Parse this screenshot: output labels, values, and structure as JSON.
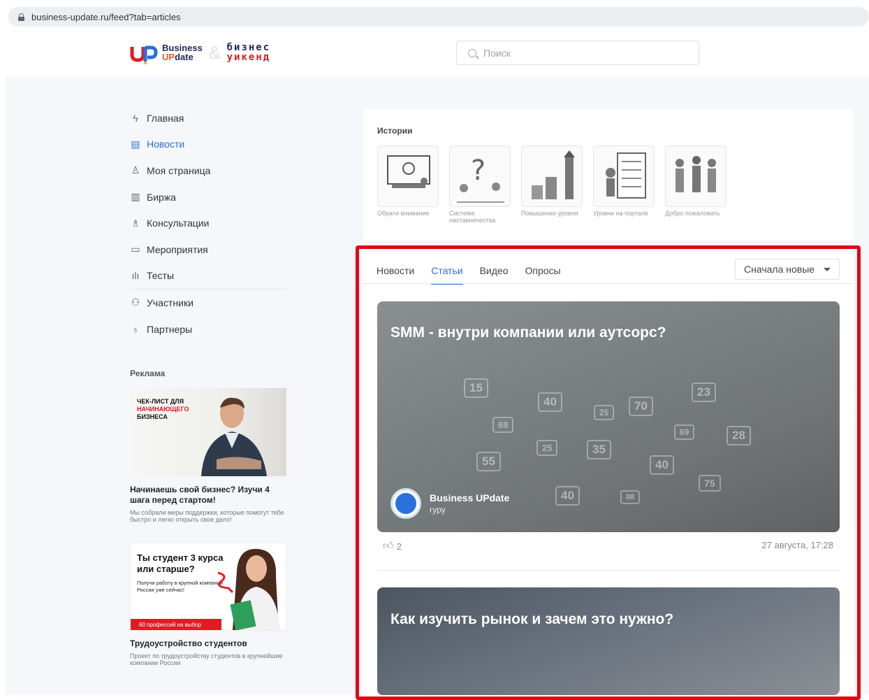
{
  "browser": {
    "url": "business-update.ru/feed?tab=articles"
  },
  "header": {
    "logo_business": "Business",
    "logo_up": "UP",
    "logo_date": "date",
    "logo_bw_line1": "бизнес",
    "logo_bw_line2": "уикенд",
    "search_placeholder": "Поиск"
  },
  "sidebar": {
    "items": [
      {
        "label": "Главная",
        "icon": "lightning-icon"
      },
      {
        "label": "Новости",
        "icon": "newspaper-icon",
        "active": true
      },
      {
        "label": "Моя страница",
        "icon": "user-icon"
      },
      {
        "label": "Биржа",
        "icon": "building-icon"
      },
      {
        "label": "Консультации",
        "icon": "consultant-icon"
      },
      {
        "label": "Мероприятия",
        "icon": "calendar-icon"
      },
      {
        "label": "Тесты",
        "icon": "bar-chart-icon"
      },
      {
        "label": "Участники",
        "icon": "users-icon"
      },
      {
        "label": "Партнеры",
        "icon": "badge-icon"
      }
    ],
    "ads_heading": "Реклама",
    "ad1": {
      "banner_line1": "ЧЕК-ЛИСТ ДЛЯ",
      "banner_line2": "НАЧИНАЮЩЕГО",
      "banner_line3": "БИЗНЕСА",
      "title": "Начинаешь свой бизнес? Изучи 4 шага перед стартом!",
      "desc": "Мы собрали меры поддержки, которые помогут тебе быстро и легко открыть свое дело!"
    },
    "ad2": {
      "banner_title": "Ты студент 3 курса или старше?",
      "banner_sub": "Получи работу в крупной компании России уже сейчас!",
      "banner_band": "60 профессий на выбор",
      "title": "Трудоустройство студентов",
      "desc": "Проект по трудоустройству студентов в крупнейшие компании России"
    }
  },
  "stories": {
    "heading": "Истории",
    "items": [
      {
        "label": "Обрати внимание"
      },
      {
        "label": "Система наставничества"
      },
      {
        "label": "Повышение уровня"
      },
      {
        "label": "Уровни на портале"
      },
      {
        "label": "Добро пожаловать"
      }
    ]
  },
  "feed": {
    "tabs": [
      {
        "label": "Новости"
      },
      {
        "label": "Статьи",
        "active": true
      },
      {
        "label": "Видео"
      },
      {
        "label": "Опросы"
      }
    ],
    "sort_label": "Сначала новые",
    "cards": [
      {
        "title": "SMM - внутри компании или аутсорс?",
        "author": "Business UPdate",
        "role": "гуру",
        "likes": "2",
        "date": "27 августа, 17:28",
        "bubbles": [
          "15",
          "40",
          "25",
          "70",
          "23",
          "69",
          "25",
          "35",
          "69",
          "28",
          "55",
          "40",
          "75",
          "40",
          "88"
        ]
      },
      {
        "title": "Как изучить рынок и зачем это нужно?"
      }
    ]
  },
  "colors": {
    "accent": "#2a6fdb",
    "highlight": "#e30613",
    "brand_red": "#e11b22"
  }
}
